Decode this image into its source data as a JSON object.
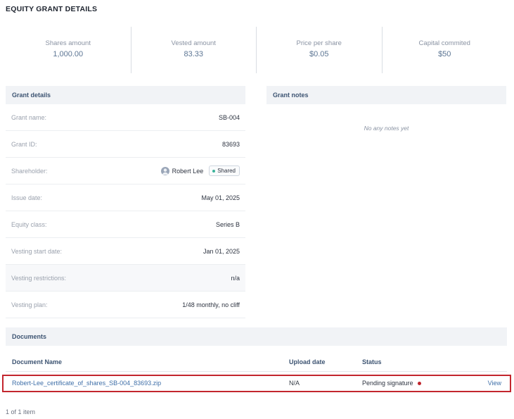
{
  "page": {
    "title": "EQUITY GRANT DETAILS"
  },
  "stats": [
    {
      "label": "Shares amount",
      "value": "1,000.00"
    },
    {
      "label": "Vested amount",
      "value": "83.33"
    },
    {
      "label": "Price per share",
      "value": "$0.05"
    },
    {
      "label": "Capital commited",
      "value": "$50"
    }
  ],
  "grant_details": {
    "header": "Grant details",
    "rows": [
      {
        "label": "Grant name:",
        "value": "SB-004"
      },
      {
        "label": "Grant ID:",
        "value": "83693"
      },
      {
        "label": "Shareholder:",
        "value": "Robert Lee",
        "badge": "Shared"
      },
      {
        "label": "Issue date:",
        "value": "May 01, 2025"
      },
      {
        "label": "Equity class:",
        "value": "Series B"
      },
      {
        "label": "Vesting start date:",
        "value": "Jan 01, 2025"
      },
      {
        "label": "Vesting restrictions:",
        "value": "n/a"
      },
      {
        "label": "Vesting plan:",
        "value": "1/48 monthly, no cliff"
      }
    ]
  },
  "grant_notes": {
    "header": "Grant notes",
    "empty_text": "No any notes yet"
  },
  "documents": {
    "header": "Documents",
    "columns": {
      "name": "Document Name",
      "upload_date": "Upload date",
      "status": "Status"
    },
    "rows": [
      {
        "name": "Robert-Lee_certificate_of_shares_SB-004_83693.zip",
        "upload_date": "N/A",
        "status": "Pending signature",
        "status_color": "#c0242c",
        "action": "View"
      }
    ]
  },
  "pagination": {
    "text": "1 of 1 item"
  },
  "colors": {
    "accent_link": "#3f6fa8",
    "highlight_border": "#c3262e",
    "shared_dot": "#3bb39a"
  }
}
